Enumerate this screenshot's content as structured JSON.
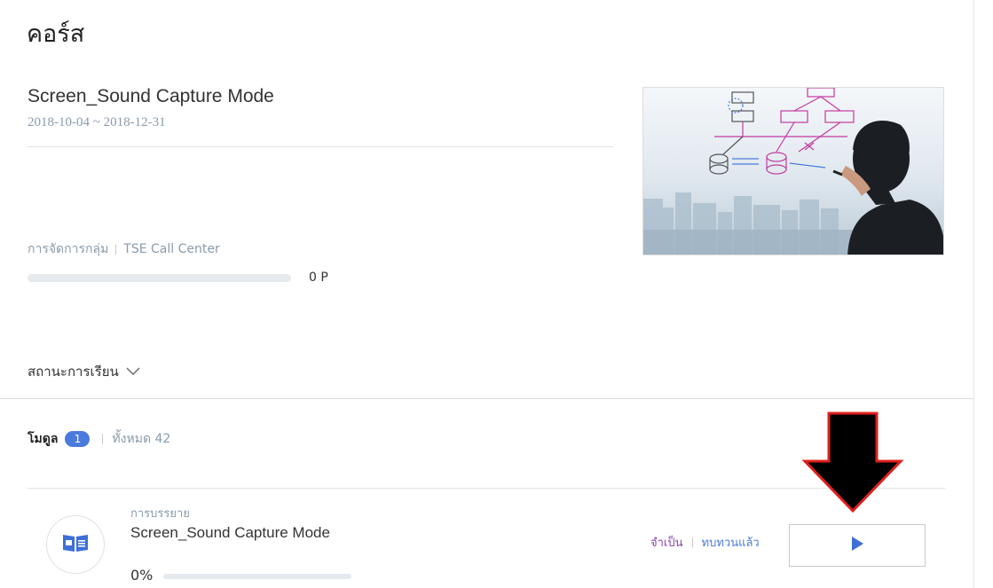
{
  "page": {
    "title": "คอร์ส"
  },
  "course": {
    "title": "Screen_Sound Capture Mode",
    "date_range": "2018-10-04 ~ 2018-12-31",
    "group_label": "การจัดการกลุ่ม",
    "group_name": "TSE Call Center",
    "progress_fraction": 0,
    "points_label": "0 P",
    "thumbnail_icon": "whiteboard-photo"
  },
  "learning_status": {
    "label": "สถานะการเรียน",
    "icon": "chevron-down-icon"
  },
  "modules": {
    "label": "โมดูล",
    "count_badge": "1",
    "total_label": "ทั้งหมด 42"
  },
  "lesson": {
    "type": "การบรรยาย",
    "title": "Screen_Sound Capture Mode",
    "percent_label": "0%",
    "progress_fraction": 0,
    "tag_required": "จำเป็น",
    "tag_reviewed": "ทบทวนแล้ว",
    "icon": "book-icon",
    "play_icon": "play-icon"
  },
  "colors": {
    "accent": "#4a7bdc",
    "annotation_arrow": "#000000",
    "annotation_outline": "#e0201b",
    "required_tag": "#8e44ad"
  }
}
